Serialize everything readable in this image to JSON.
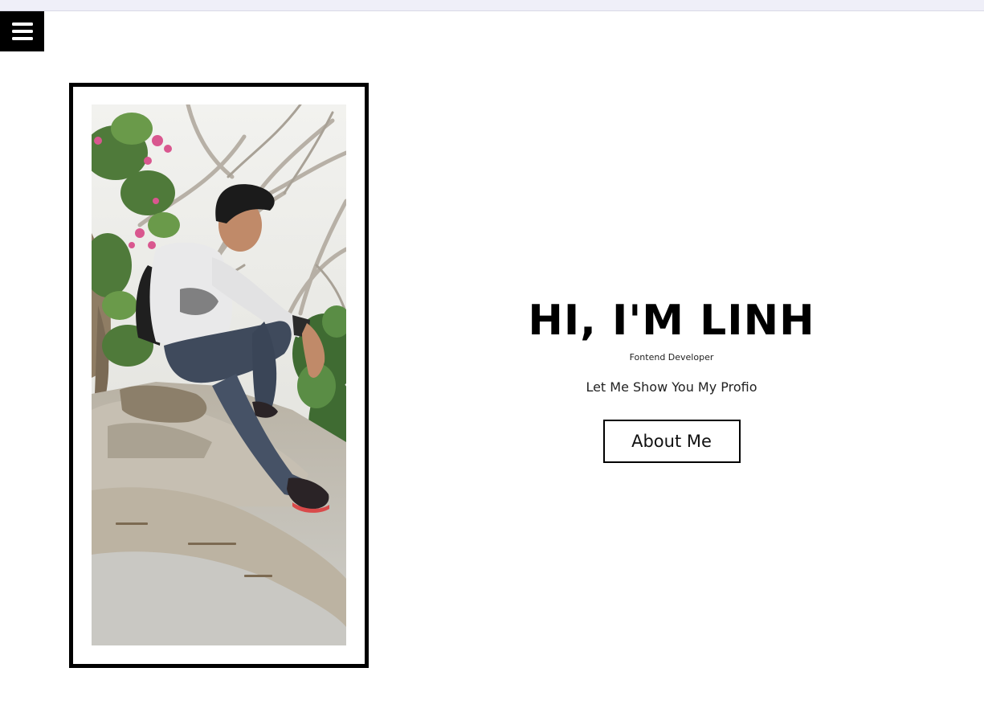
{
  "header": {
    "menu_icon": "hamburger-menu-icon",
    "menu_color": "#000000"
  },
  "hero": {
    "title": "HI, I'M LINH",
    "role": "Fontend Developer",
    "tagline": "Let Me Show You My Profio",
    "about_button_label": "About Me"
  },
  "profile_photo": {
    "subject": "young man sitting on a rock among trees with pink flowers, wearing a white hoodie, jeans and a backpack"
  },
  "colors": {
    "background": "#ffffff",
    "text": "#000000",
    "frame_border": "#000000",
    "top_strip": "#efeff8"
  }
}
